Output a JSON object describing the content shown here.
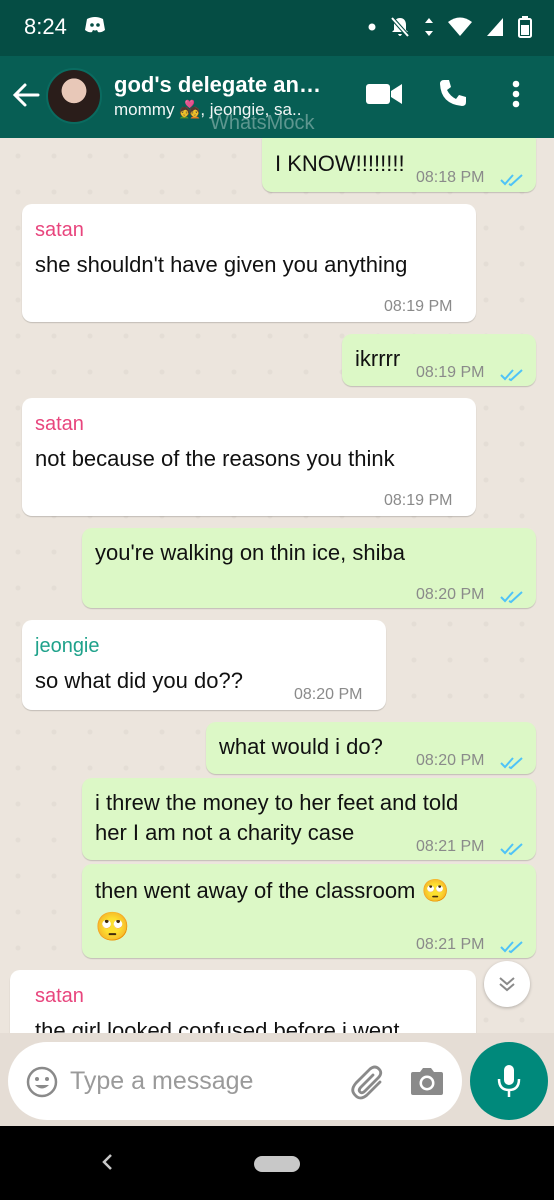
{
  "status_bar": {
    "time": "8:24"
  },
  "header": {
    "title": "god's delegate an…",
    "subtitle": "mommy 💑, jeongie, sa..",
    "watermark": "WhatsMock"
  },
  "messages": [
    {
      "dir": "out",
      "text": "I KNOW!!!!!!!!",
      "time": "08:18 PM",
      "ticks": "read"
    },
    {
      "dir": "in",
      "sender": "satan",
      "sender_color": "#e8457d",
      "text": "she shouldn't have given you anything",
      "time": "08:19 PM"
    },
    {
      "dir": "out",
      "text": "ikrrrr",
      "time": "08:19 PM",
      "ticks": "read"
    },
    {
      "dir": "in",
      "sender": "satan",
      "sender_color": "#e8457d",
      "text": "not because of the reasons you think",
      "time": "08:19 PM"
    },
    {
      "dir": "out",
      "text": "you're walking on thin ice, shiba",
      "time": "08:20 PM",
      "ticks": "read"
    },
    {
      "dir": "in",
      "sender": "jeongie",
      "sender_color": "#1fa28b",
      "text": "so what did you do??",
      "time": "08:20 PM"
    },
    {
      "dir": "out",
      "text": "what would i do?",
      "time": "08:20 PM",
      "ticks": "read"
    },
    {
      "dir": "out",
      "text_line1": "i threw the money to her feet and told",
      "text_line2": "her I am not a charity case",
      "time": "08:21 PM",
      "ticks": "read"
    },
    {
      "dir": "out",
      "text_line1": "then went away of the classroom 🙄",
      "text_line2": "🙄",
      "time": "08:21 PM",
      "ticks": "read"
    },
    {
      "dir": "in",
      "sender": "satan",
      "sender_color": "#e8457d",
      "text": "the girl looked confused before i went"
    }
  ],
  "composer": {
    "placeholder": "Type a message"
  },
  "icons": {
    "status": [
      "discord-icon",
      "dot-icon",
      "do-not-disturb-icon",
      "data-arrows-icon",
      "wifi-icon",
      "signal-icon",
      "battery-icon"
    ],
    "header": [
      "back-arrow-icon",
      "video-call-icon",
      "phone-icon",
      "more-vert-icon"
    ],
    "composer": [
      "emoji-icon",
      "attach-icon",
      "camera-icon",
      "mic-icon"
    ],
    "chat": [
      "chevron-down-icon",
      "double-check-icon"
    ]
  },
  "colors": {
    "status_bar": "#054d44",
    "app_bar": "#075e54",
    "outgoing_bubble": "#dcf8c6",
    "incoming_bubble": "#ffffff",
    "read_ticks": "#4fc3f7",
    "mic_button": "#00897b"
  }
}
